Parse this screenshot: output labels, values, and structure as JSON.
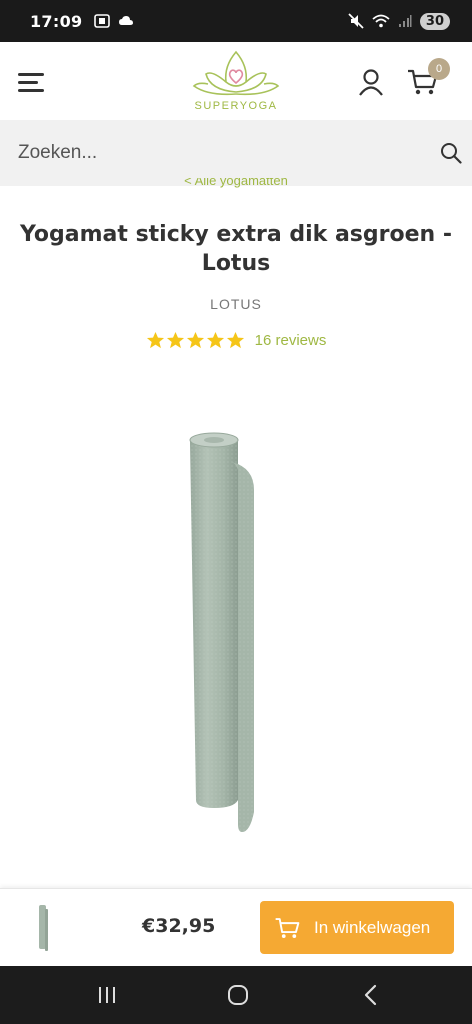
{
  "status_bar": {
    "time": "17:09",
    "battery": "30",
    "icons": [
      "screenshot-icon",
      "cloud-icon",
      "mute-icon",
      "wifi-icon",
      "signal-icon"
    ]
  },
  "header": {
    "logo_text": "SUPERYOGA",
    "cart_count": "0",
    "icons": [
      "hamburger-menu-icon",
      "user-icon",
      "cart-icon"
    ]
  },
  "search": {
    "placeholder": "Zoeken..."
  },
  "breadcrumb": {
    "back_label": "< Alle yogamatten"
  },
  "product": {
    "title": "Yogamat sticky extra dik asgroen - Lotus",
    "brand": "LOTUS",
    "rating": 5,
    "rating_max": 5,
    "reviews": "16 reviews",
    "image_description_color": "#a9b8ad"
  },
  "sticky_bar": {
    "price": "€32,95",
    "cta_label": "In winkelwagen"
  },
  "colors": {
    "accent_green": "#9fb843",
    "cta_orange": "#f5a933",
    "star_yellow": "#f5c518",
    "badge": "#b9a88a"
  }
}
